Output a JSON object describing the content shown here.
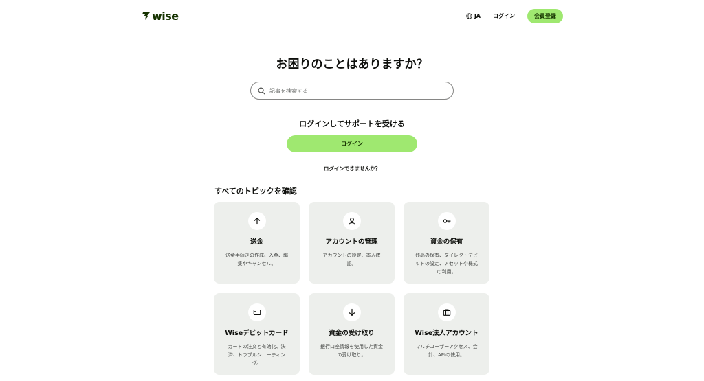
{
  "header": {
    "logo_text": "wise",
    "language": "JA",
    "login": "ログイン",
    "signup": "会員登録"
  },
  "hero": {
    "title": "お困りのことはありますか？",
    "search_placeholder": "記事を検索する"
  },
  "login_section": {
    "heading": "ログインしてサポートを受ける",
    "button": "ログイン",
    "cant_login": "ログインできませんか？"
  },
  "topics": {
    "heading": "すべてのトピックを確認",
    "cards": [
      {
        "icon": "arrow-up-icon",
        "title": "送金",
        "desc": "送金手続きの作成、入金、編集やキャンセル。"
      },
      {
        "icon": "person-icon",
        "title": "アカウントの管理",
        "desc": "アカウントの設定、本人確認。"
      },
      {
        "icon": "key-icon",
        "title": "資金の保有",
        "desc": "残高の保有、ダイレクトデビットの設定、アセットや株式の利用。"
      },
      {
        "icon": "card-icon",
        "title": "Wiseデビットカード",
        "desc": "カードの注文と有効化、決済、トラブルシューティング。"
      },
      {
        "icon": "arrow-down-icon",
        "title": "資金の受け取り",
        "desc": "銀行口座情報を使用した資金の受け取り。"
      },
      {
        "icon": "briefcase-icon",
        "title": "Wise法人アカウント",
        "desc": "マルチユーザーアクセス、会計、APIの使用。"
      }
    ]
  },
  "colors": {
    "accent": "#9fe870",
    "brand_dark": "#163300",
    "card_bg": "#edefec"
  }
}
